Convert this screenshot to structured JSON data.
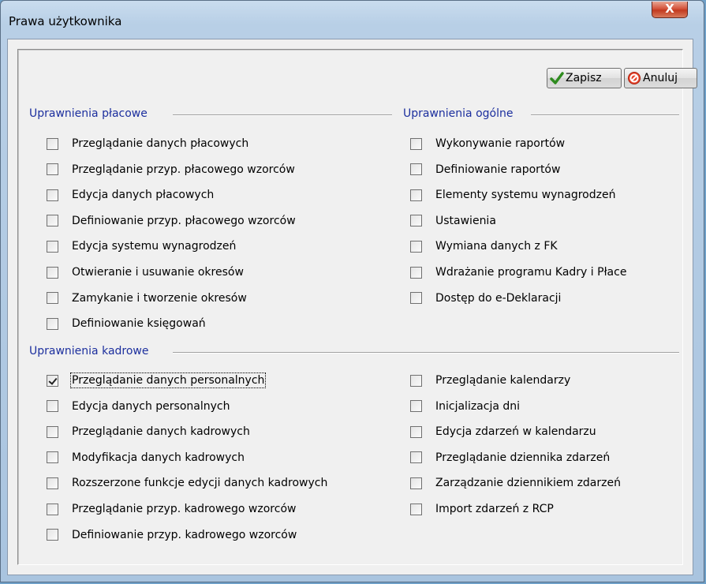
{
  "window": {
    "title": "Prawa użytkownika",
    "close_label": "X"
  },
  "toolbar": {
    "save_label": "Zapisz",
    "cancel_label": "Anuluj"
  },
  "groups": {
    "placowe": {
      "title": "Uprawnienia płacowe",
      "items": [
        {
          "label": "Przeglądanie danych płacowych",
          "checked": false
        },
        {
          "label": "Przeglądanie przyp. płacowego wzorców",
          "checked": false
        },
        {
          "label": "Edycja danych płacowych",
          "checked": false
        },
        {
          "label": "Definiowanie przyp. płacowego wzorców",
          "checked": false
        },
        {
          "label": "Edycja systemu wynagrodzeń",
          "checked": false
        },
        {
          "label": "Otwieranie i usuwanie okresów",
          "checked": false
        },
        {
          "label": "Zamykanie i tworzenie okresów",
          "checked": false
        },
        {
          "label": "Definiowanie księgowań",
          "checked": false
        }
      ]
    },
    "ogolne": {
      "title": "Uprawnienia ogólne",
      "items": [
        {
          "label": "Wykonywanie raportów",
          "checked": false
        },
        {
          "label": "Definiowanie raportów",
          "checked": false
        },
        {
          "label": "Elementy systemu wynagrodzeń",
          "checked": false
        },
        {
          "label": "Ustawienia",
          "checked": false
        },
        {
          "label": "Wymiana danych z FK",
          "checked": false
        },
        {
          "label": "Wdrażanie programu Kadry i Płace",
          "checked": false
        },
        {
          "label": "Dostęp do e-Deklaracji",
          "checked": false
        }
      ]
    },
    "kadrowe": {
      "title": "Uprawnienia kadrowe",
      "left": [
        {
          "label": "Przeglądanie danych personalnych",
          "checked": true
        },
        {
          "label": "Edycja danych personalnych",
          "checked": false
        },
        {
          "label": "Przeglądanie danych kadrowych",
          "checked": false
        },
        {
          "label": "Modyfikacja danych kadrowych",
          "checked": false
        },
        {
          "label": "Rozszerzone funkcje edycji danych kadrowych",
          "checked": false
        },
        {
          "label": "Przeglądanie przyp. kadrowego wzorców",
          "checked": false
        },
        {
          "label": "Definiowanie przyp. kadrowego wzorców",
          "checked": false
        }
      ],
      "right": [
        {
          "label": "Przeglądanie kalendarzy",
          "checked": false
        },
        {
          "label": "Inicjalizacja dni",
          "checked": false
        },
        {
          "label": "Edycja zdarzeń w kalendarzu",
          "checked": false
        },
        {
          "label": "Przeglądanie dziennika zdarzeń",
          "checked": false
        },
        {
          "label": "Zarządzanie dziennikiem zdarzeń",
          "checked": false
        },
        {
          "label": "Import zdarzeń z RCP",
          "checked": false
        }
      ]
    }
  }
}
